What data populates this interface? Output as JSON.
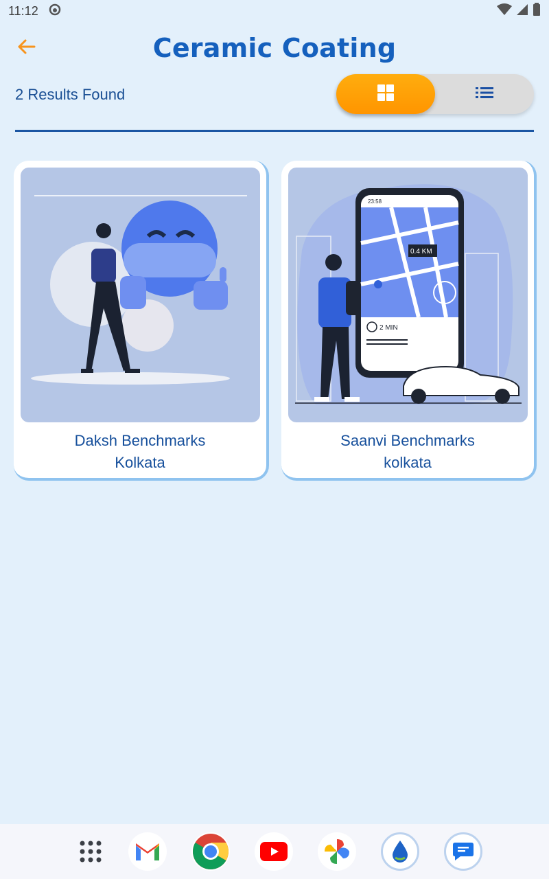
{
  "status_bar": {
    "time": "11:12"
  },
  "header": {
    "title": "Ceramic Coating"
  },
  "results": {
    "count_text": "2 Results Found"
  },
  "view_toggle": {
    "selected": "grid"
  },
  "cards": [
    {
      "name": "Daksh Benchmarks",
      "city": "Kolkata",
      "image": "masked-man-illustration"
    },
    {
      "name": "Saanvi Benchmarks",
      "city": "kolkata",
      "image": "ride-app-map-illustration"
    }
  ],
  "colors": {
    "accent": "#ff9f0a",
    "title": "#1560bd",
    "background": "#e3f0fb",
    "card_border": "#8fc3ef"
  },
  "phone_illustration": {
    "time": "23:58",
    "distance": "0.4 KM",
    "eta": "2 MIN"
  },
  "dock": [
    "apps-grid-icon",
    "gmail-icon",
    "chrome-icon",
    "youtube-icon",
    "photos-icon",
    "water-drop-app-icon",
    "messages-icon"
  ]
}
